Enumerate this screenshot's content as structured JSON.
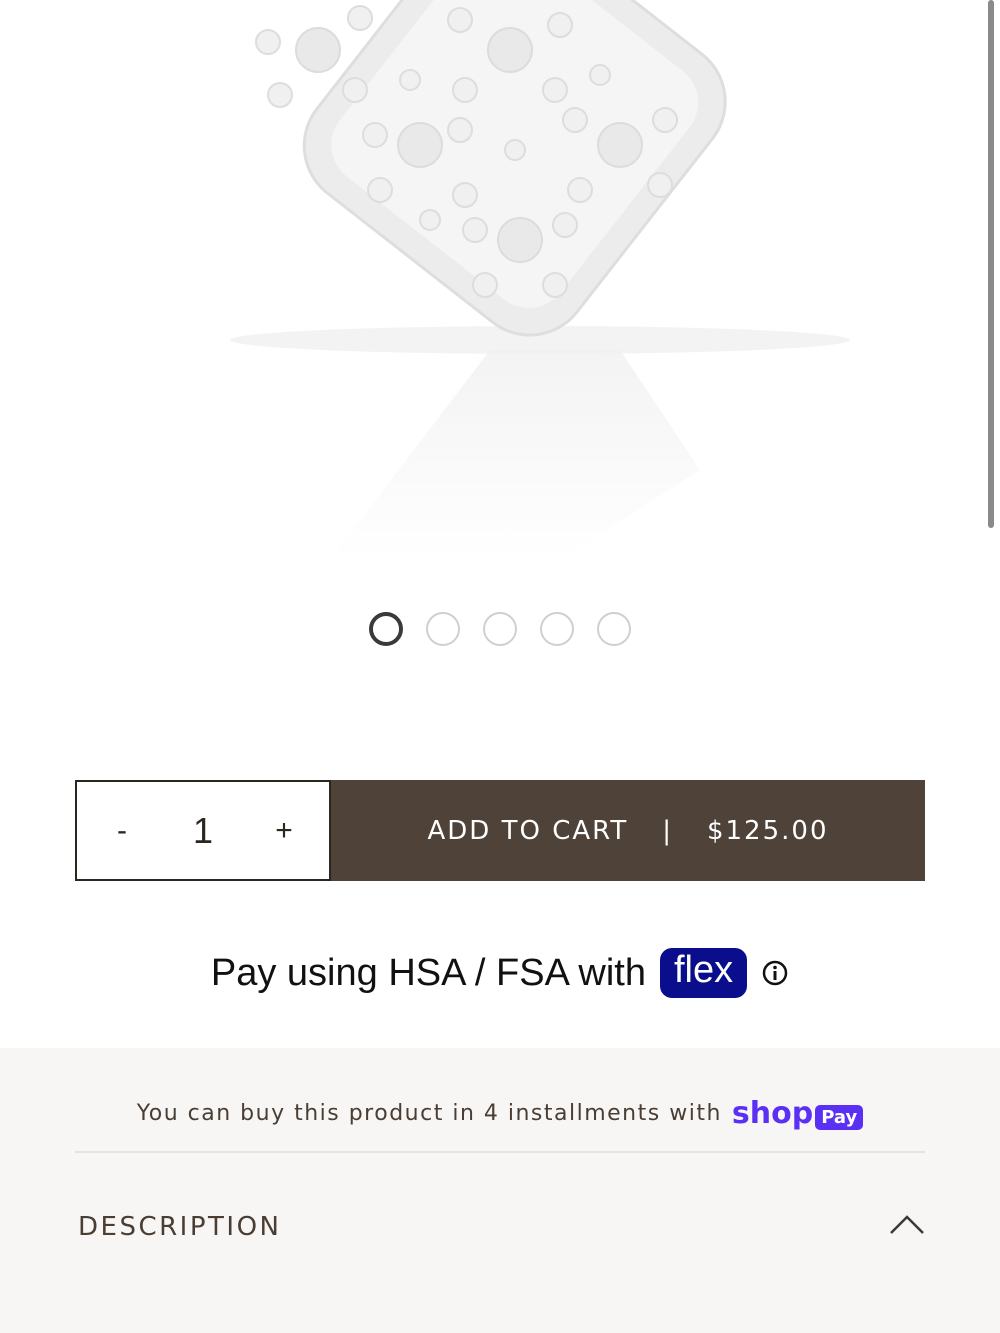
{
  "carousel": {
    "slide_count": 5,
    "active_index": 0
  },
  "quantity": {
    "minus": "-",
    "value": "1",
    "plus": "+"
  },
  "cart": {
    "label": "ADD TO CART",
    "separator": "|",
    "price": "$125.00"
  },
  "hsa": {
    "text": "Pay using HSA / FSA with",
    "badge": "flex"
  },
  "installments": {
    "text": "You can buy this product in 4 installments with",
    "shop": "shop",
    "pay": "Pay"
  },
  "description": {
    "title": "DESCRIPTION"
  },
  "colors": {
    "cart_bg": "#4f4238",
    "flex_blue": "#0a0e8c",
    "shop_purple": "#5a31f4"
  }
}
